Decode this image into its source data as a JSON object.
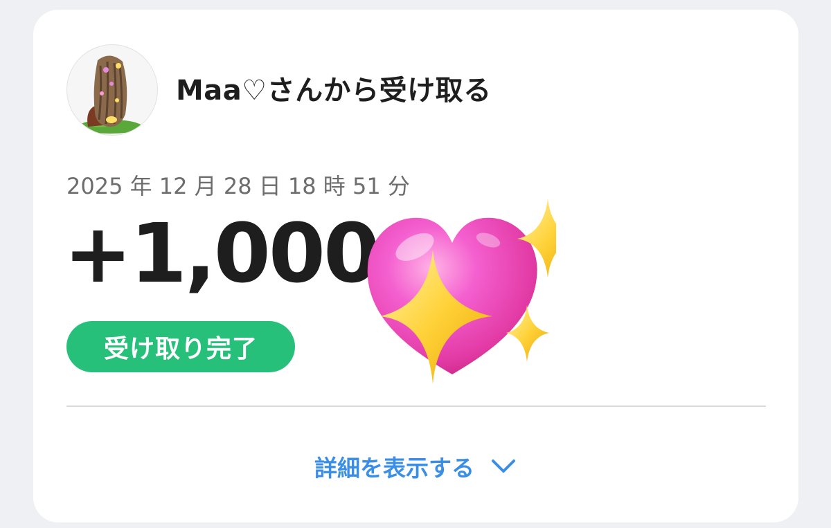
{
  "header": {
    "title": "Maa♡さんから受け取る",
    "avatar": "user-avatar-illustration"
  },
  "transaction": {
    "datetime": "2025 年 12 月 28 日 18 時 51 分",
    "amount": "+1,000",
    "status": "受け取り完了",
    "status_color": "#26c07a"
  },
  "sticker": {
    "icon": "sparkling-heart-icon"
  },
  "footer": {
    "details_label": "詳細を表示する",
    "details_icon": "chevron-down-icon",
    "link_color": "#3a8ee6"
  }
}
